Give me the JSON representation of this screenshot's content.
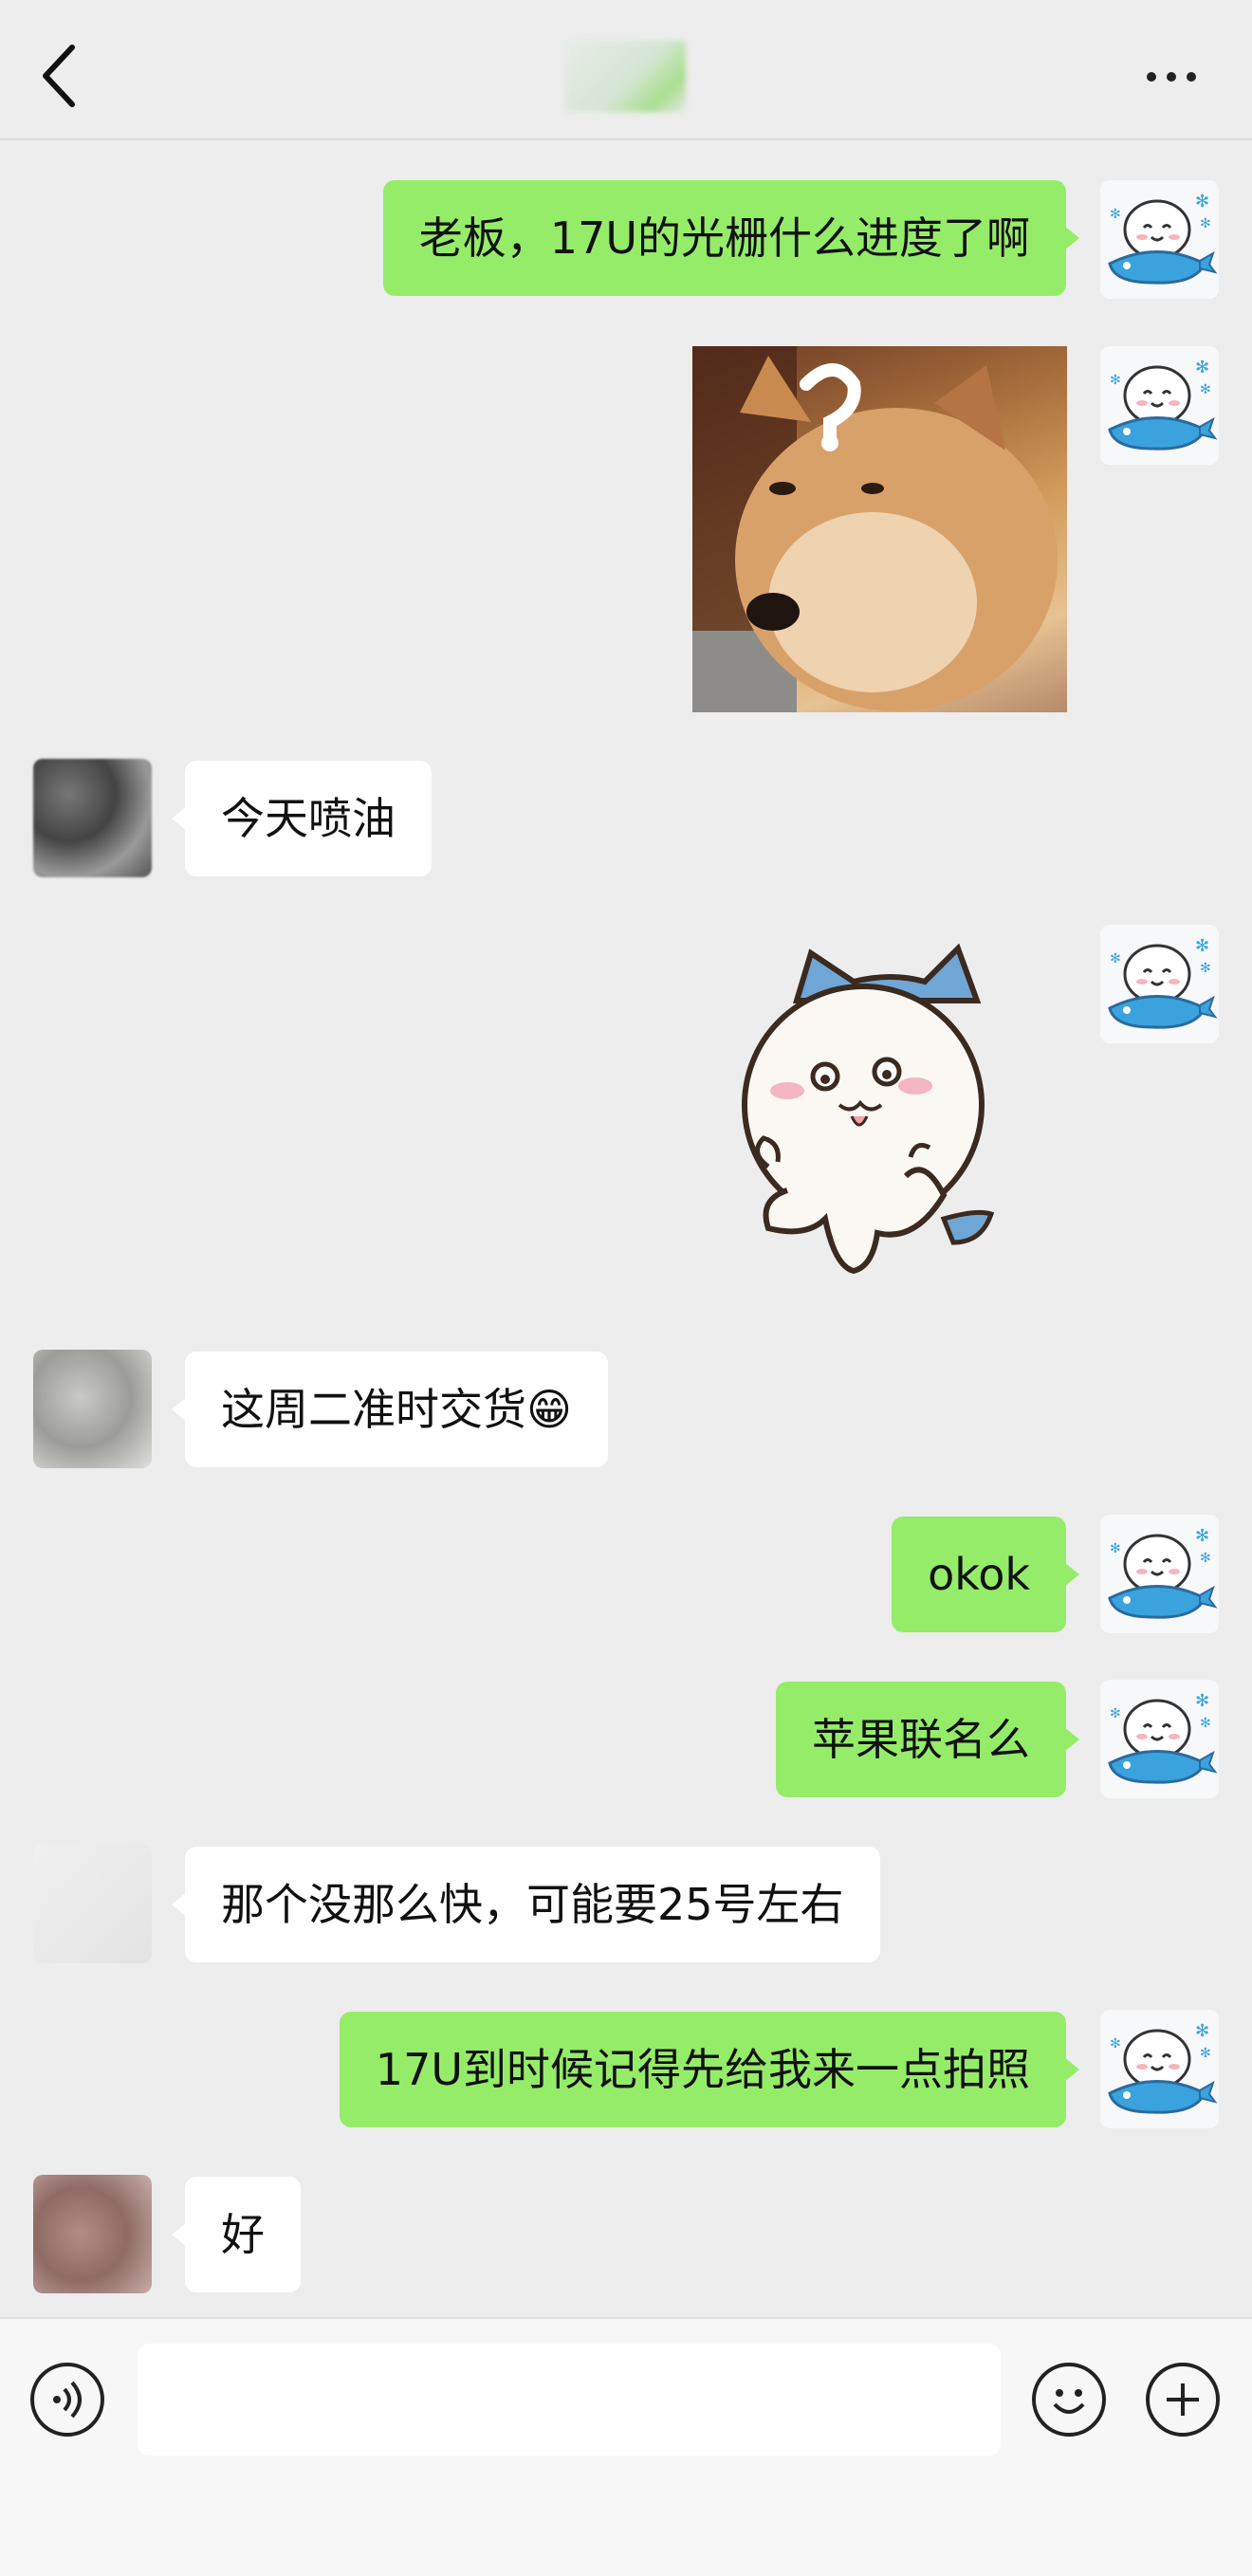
{
  "header": {
    "title": "",
    "back_icon": "chevron-left-icon",
    "more_icon": "more-dots-icon"
  },
  "messages": [
    {
      "side": "me",
      "type": "text",
      "text": "老板，17U的光栅什么进度了啊"
    },
    {
      "side": "me",
      "type": "image",
      "desc": "shiba-question-meme"
    },
    {
      "side": "them",
      "type": "text",
      "text": "今天喷油"
    },
    {
      "side": "me",
      "type": "sticker",
      "desc": "cartoon-cat-sticker"
    },
    {
      "side": "them",
      "type": "text",
      "text": "这周二准时交货😁"
    },
    {
      "side": "me",
      "type": "text",
      "text": "okok"
    },
    {
      "side": "me",
      "type": "text",
      "text": "苹果联名么"
    },
    {
      "side": "them",
      "type": "text",
      "text": "那个没那么快，可能要25号左右"
    },
    {
      "side": "me",
      "type": "text",
      "text": "17U到时候记得先给我来一点拍照"
    },
    {
      "side": "them",
      "type": "text",
      "text": "好"
    }
  ],
  "input_bar": {
    "voice_icon": "voice-mode-icon",
    "input_value": "",
    "mic_icon": "microphone-icon",
    "emoji_icon": "emoji-icon",
    "plus_icon": "plus-icon"
  },
  "colors": {
    "my_bubble": "#95ec69",
    "their_bubble": "#ffffff",
    "background": "#ededed"
  }
}
